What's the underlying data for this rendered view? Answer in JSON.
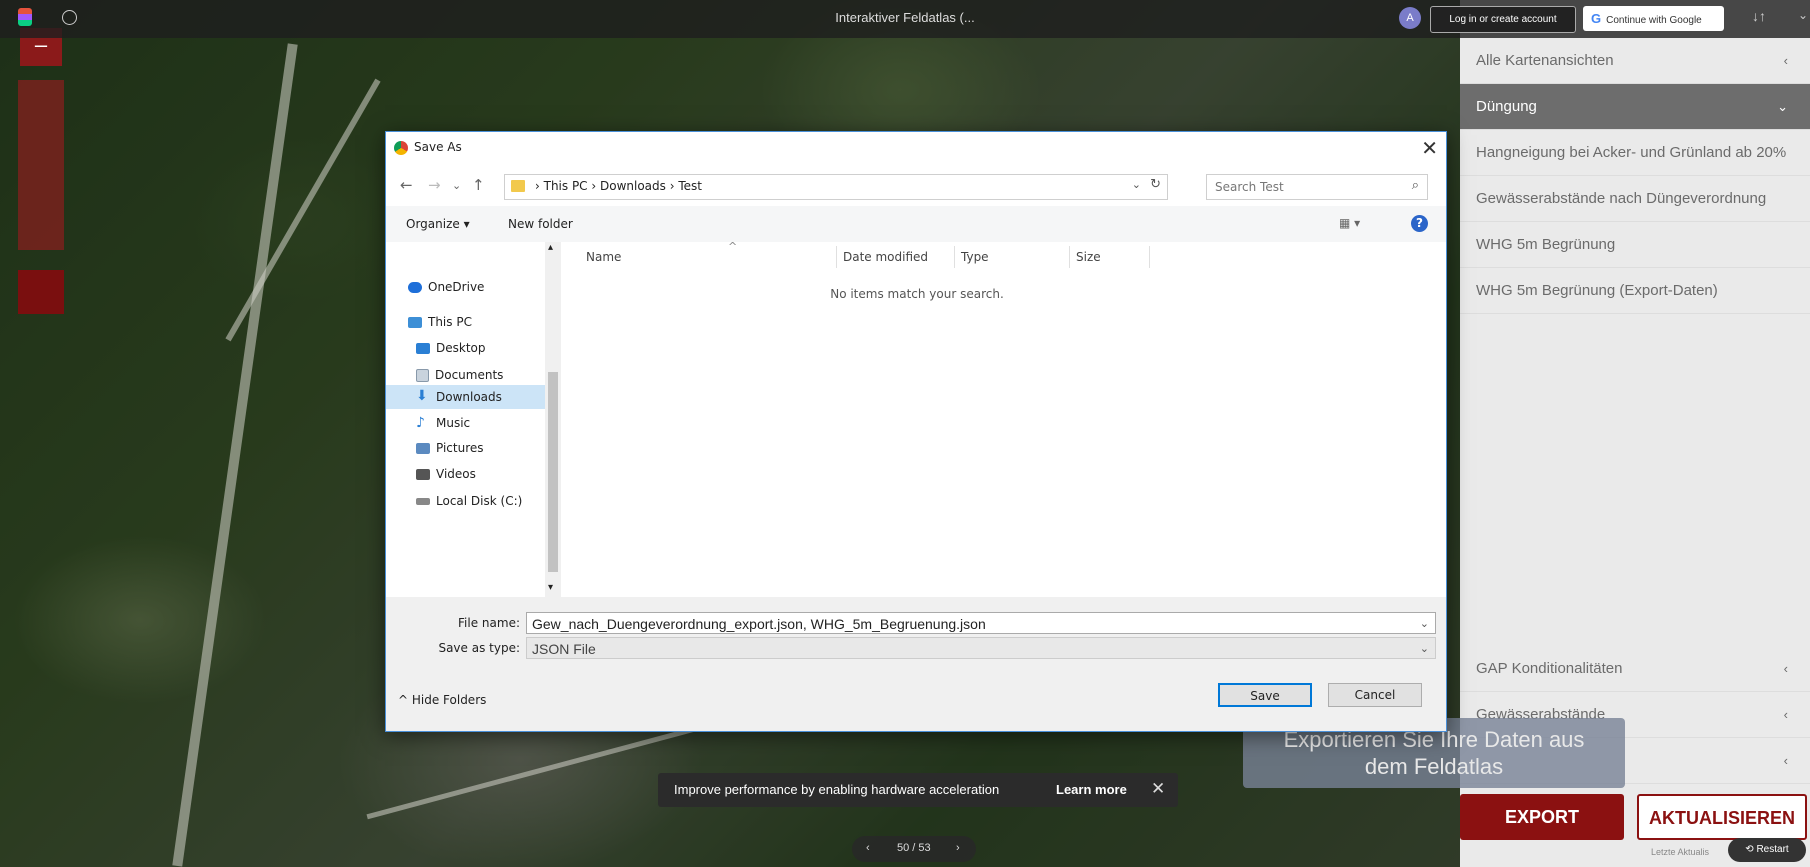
{
  "topbar": {
    "title": "Interaktiver Feldatlas (...",
    "avatar_letter": "A",
    "login_label": "Log in or create account",
    "google_label": "Continue with Google",
    "google_g": "G",
    "sort_icon": "↓↑",
    "chevron": "⌄"
  },
  "map": {
    "zoom_minus": "–"
  },
  "panel": {
    "items": [
      {
        "label": "Alle Kartenansichten",
        "chevron": "‹"
      },
      {
        "label": "Düngung",
        "chevron": "⌄"
      },
      {
        "label": "Hangneigung bei Acker- und Grünland ab 20%"
      },
      {
        "label": "Gewässerabstände nach Düngeverordnung"
      },
      {
        "label": "WHG 5m Begrünung"
      },
      {
        "label": "WHG 5m Begrünung (Export-Daten)"
      }
    ],
    "bottom_items": [
      {
        "label": "GAP Konditionalitäten",
        "chevron": "‹"
      },
      {
        "label": "Gewässerabstände",
        "chevron": "‹"
      },
      {
        "label": "",
        "chevron": "‹"
      }
    ],
    "export_label": "EXPORT",
    "aktualisieren_label": "AKTUALISIEREN",
    "letzte_label": "Letzte Aktualis",
    "restart_label": "⟲ Restart"
  },
  "tooltip": {
    "line1": "Exportieren Sie Ihre Daten aus",
    "line2": "dem Feldatlas"
  },
  "toast": {
    "message": "Improve performance by enabling hardware acceleration",
    "learn_more": "Learn more",
    "close": "✕"
  },
  "pager": {
    "prev": "‹",
    "text": "50 / 53",
    "next": "›"
  },
  "dialog": {
    "title": "Save As",
    "close": "✕",
    "nav": {
      "back": "←",
      "forward": "→",
      "recent": "⌄",
      "up": "↑"
    },
    "breadcrumb": "›  This PC  ›  Downloads  ›  Test",
    "address_dropdown": "⌄",
    "refresh": "↻",
    "search_placeholder": "Search Test",
    "search_icon": "⌕",
    "organize_label": "Organize ▾",
    "new_folder_label": "New folder",
    "view_icon": "▦ ▾",
    "help": "?",
    "tree": [
      {
        "label": "OneDrive",
        "icon": "cloud-icon",
        "color": "#1e6fd9"
      },
      {
        "label": "This PC",
        "icon": "computer-icon",
        "color": "#3d8fd6"
      },
      {
        "label": "Desktop",
        "icon": "desktop-icon",
        "color": "#2a7fd4"
      },
      {
        "label": "Documents",
        "icon": "documents-icon",
        "color": "#c9d3dd"
      },
      {
        "label": "Downloads",
        "icon": "downloads-icon",
        "color": "#2a7fd4"
      },
      {
        "label": "Music",
        "icon": "music-icon",
        "color": "#2a7fd4"
      },
      {
        "label": "Pictures",
        "icon": "pictures-icon",
        "color": "#5b8ac0"
      },
      {
        "label": "Videos",
        "icon": "videos-icon",
        "color": "#555"
      },
      {
        "label": "Local Disk (C:)",
        "icon": "disk-icon",
        "color": "#888"
      }
    ],
    "scroll_up": "▴",
    "scroll_down": "▾",
    "columns": [
      "Name",
      "Date modified",
      "Type",
      "Size"
    ],
    "sort_arrow": "^",
    "empty_message": "No items match your search.",
    "file_name_label": "File name:",
    "file_name_value": "Gew_nach_Duengeverordnung_export.json, WHG_5m_Begruenung.json",
    "save_type_label": "Save as type:",
    "save_type_value": "JSON File",
    "dropdown": "⌄",
    "hide_folders": "^  Hide Folders",
    "save_label": "Save",
    "cancel_label": "Cancel"
  }
}
